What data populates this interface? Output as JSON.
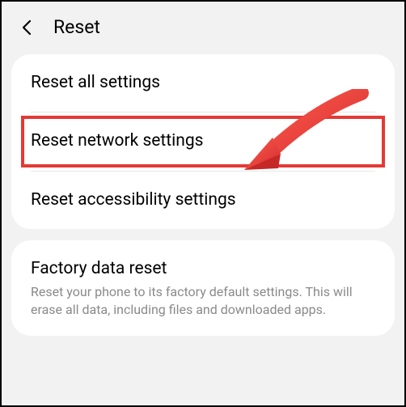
{
  "header": {
    "title": "Reset"
  },
  "section1": {
    "items": [
      {
        "title": "Reset all settings"
      },
      {
        "title": "Reset network settings"
      },
      {
        "title": "Reset accessibility settings"
      }
    ]
  },
  "section2": {
    "items": [
      {
        "title": "Factory data reset",
        "subtitle": "Reset your phone to its factory default settings. This will erase all data, including files and downloaded apps."
      }
    ]
  },
  "annotation": {
    "highlight_color": "#e53935",
    "arrow_color": "#e53935"
  }
}
